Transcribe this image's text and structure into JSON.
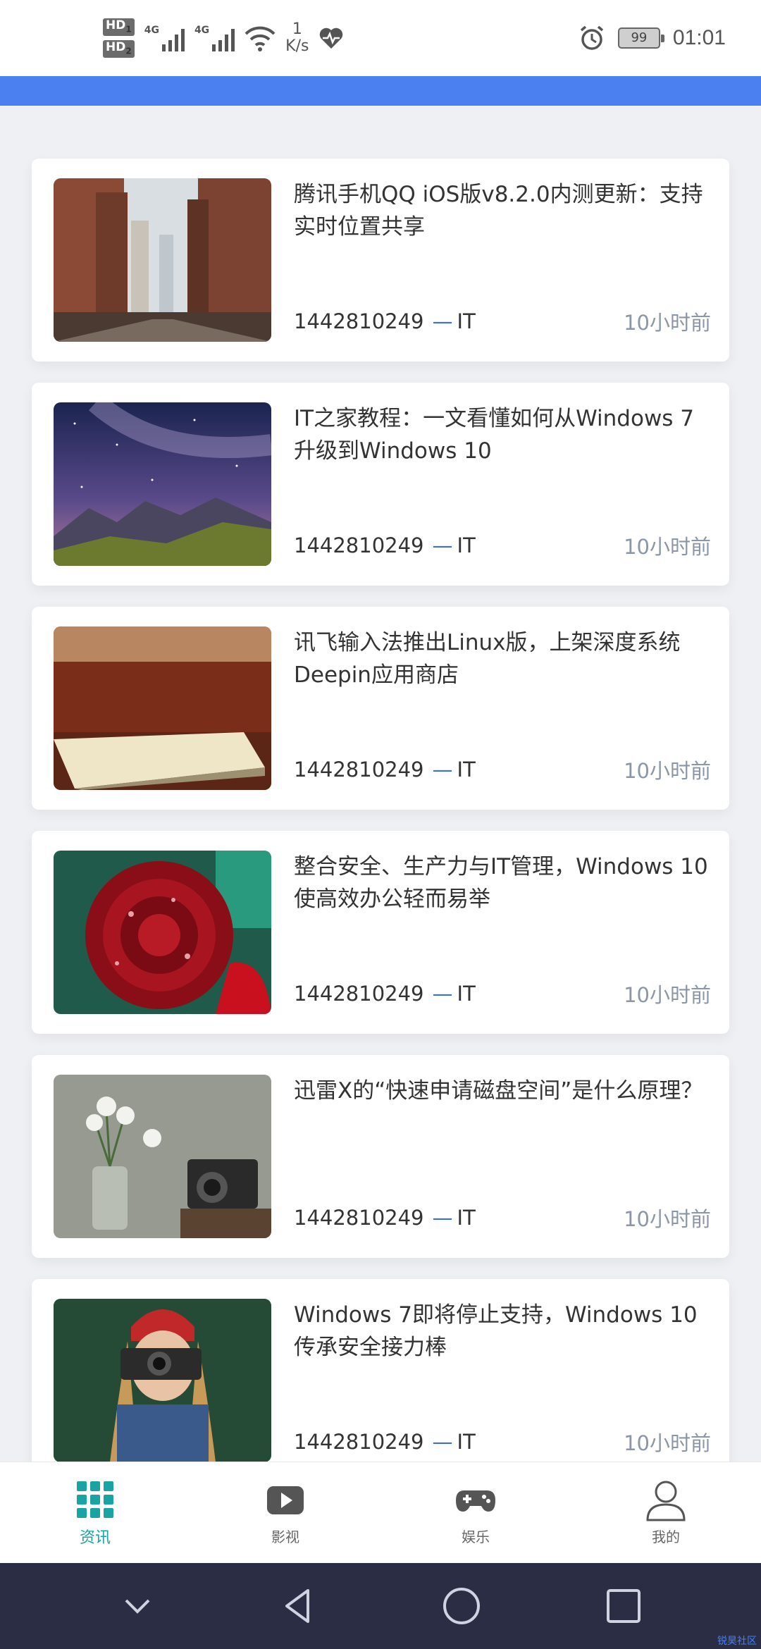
{
  "status_bar": {
    "hd1": "HD",
    "hd1_sub": "1",
    "hd2": "HD",
    "hd2_sub": "2",
    "signal1_label": "4G",
    "signal2_label": "4G",
    "speed_value": "1",
    "speed_unit": "K/s",
    "battery": "99",
    "time": "01:01"
  },
  "feed": {
    "articles": [
      {
        "title": "腾讯手机QQ iOS版v8.2.0内测更新：支持实时位置共享",
        "author": "1442810249",
        "dash": "—",
        "category": "IT",
        "time": "10小时前",
        "image": "brick-alley"
      },
      {
        "title": "IT之家教程：一文看懂如何从Windows 7升级到Windows 10",
        "author": "1442810249",
        "dash": "—",
        "category": "IT",
        "time": "10小时前",
        "image": "starry-mountains"
      },
      {
        "title": "讯飞输入法推出Linux版，上架深度系统Deepin应用商店",
        "author": "1442810249",
        "dash": "—",
        "category": "IT",
        "time": "10小时前",
        "image": "phone-on-table"
      },
      {
        "title": "整合安全、生产力与IT管理，Windows 10使高效办公轻而易举",
        "author": "1442810249",
        "dash": "—",
        "category": "IT",
        "time": "10小时前",
        "image": "red-rose"
      },
      {
        "title": "迅雷X的“快速申请磁盘空间”是什么原理？",
        "author": "1442810249",
        "dash": "—",
        "category": "IT",
        "time": "10小时前",
        "image": "flowers-camera"
      },
      {
        "title": "Windows 7即将停止支持，Windows 10传承安全接力棒",
        "author": "1442810249",
        "dash": "—",
        "category": "IT",
        "time": "10小时前",
        "image": "girl-camera"
      }
    ]
  },
  "tabs": [
    {
      "label": "资讯",
      "icon": "grid-icon",
      "active": true
    },
    {
      "label": "影视",
      "icon": "play-icon",
      "active": false
    },
    {
      "label": "娱乐",
      "icon": "gamepad-icon",
      "active": false
    },
    {
      "label": "我的",
      "icon": "user-icon",
      "active": false
    }
  ],
  "colors": {
    "accent": "#4a80f0",
    "active_tab": "#1aa3a3",
    "time_gray": "#8b96a6",
    "nav_bg": "#2b2d45"
  },
  "watermark": "锐昊社区"
}
